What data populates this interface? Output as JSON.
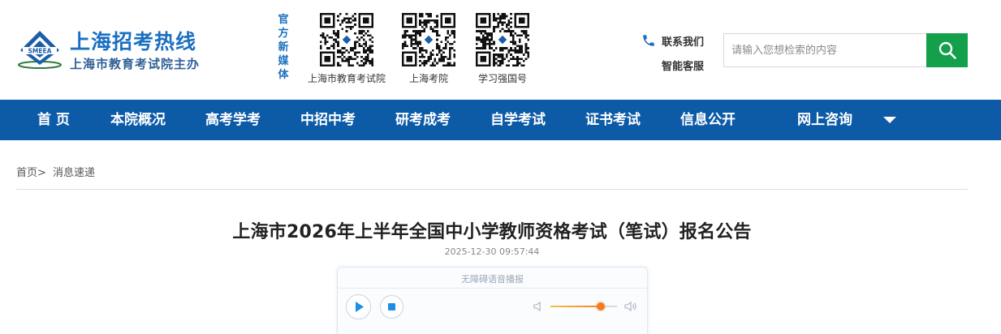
{
  "brand": {
    "title": "上海招考热线",
    "subtitle": "上海市教育考试院主办",
    "emblem_text": "SMEEA",
    "color": "#1a6fc0"
  },
  "media": {
    "label_chars": [
      "官",
      "方",
      "新",
      "媒",
      "体"
    ],
    "qr_codes": [
      {
        "icon": "qr-code-icon",
        "caption": "上海市教育考试院"
      },
      {
        "icon": "qr-code-icon",
        "caption": "上海考院"
      },
      {
        "icon": "qr-code-icon",
        "caption": "学习强国号"
      }
    ]
  },
  "contact": {
    "icon": "phone-icon",
    "contact_label": "联系我们",
    "service_label": "智能客服"
  },
  "search": {
    "placeholder": "请输入您想检索的内容",
    "value": "",
    "button_icon": "search-icon",
    "button_color": "#14a04a"
  },
  "nav": {
    "background": "#0d5aa7",
    "items": [
      "首 页",
      "本院概况",
      "高考学考",
      "中招中考",
      "研考成考",
      "自学考试",
      "证书考试",
      "信息公开",
      "网上咨询"
    ],
    "dropdown_icon": "caret-down-icon"
  },
  "breadcrumb": {
    "home": "首页>",
    "current": "消息速递"
  },
  "article": {
    "title": "上海市2026年上半年全国中小学教师资格考试（笔试）报名公告",
    "datetime": "2025-12-30 09:57:44"
  },
  "player": {
    "label": "无障碍语音播报",
    "play_icon": "play-icon",
    "stop_icon": "stop-icon",
    "volume_low_icon": "volume-low-icon",
    "volume_high_icon": "volume-high-icon",
    "volume_level": 0.76,
    "accent_color": "#f47a22"
  }
}
